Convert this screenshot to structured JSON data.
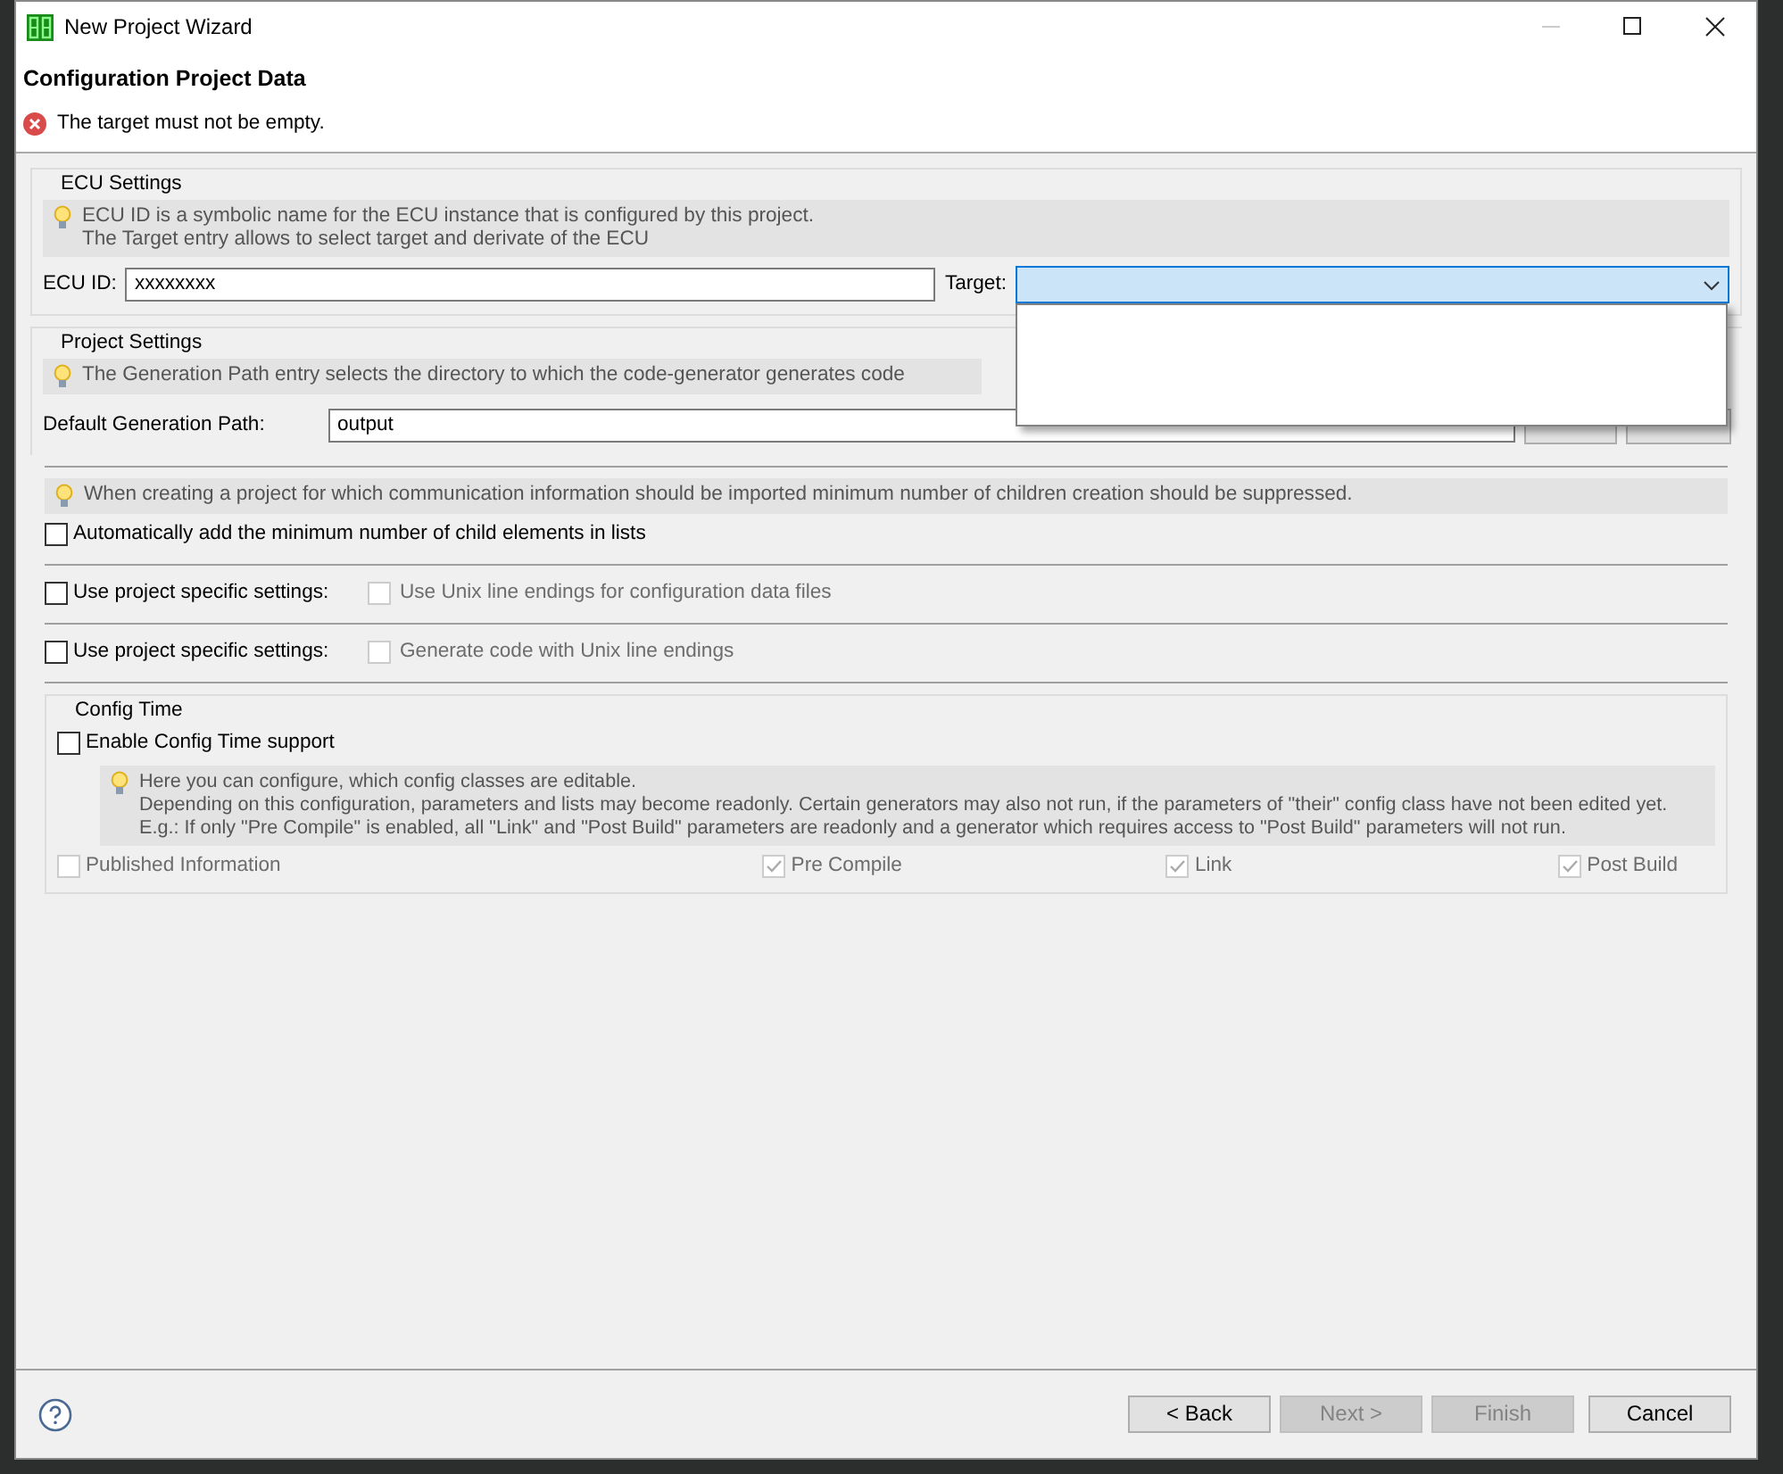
{
  "window": {
    "title": "New Project Wizard"
  },
  "header": {
    "title": "Configuration Project Data",
    "error": "The target must not be empty."
  },
  "ecu_settings": {
    "legend": "ECU Settings",
    "info": [
      "ECU ID is a symbolic name for the ECU instance that is configured by this project.",
      "The Target entry allows to select target and derivate of the ECU"
    ],
    "ecu_id": {
      "label": "ECU ID:",
      "value": "xxxxxxxx"
    },
    "target": {
      "label": "Target:",
      "expanded": true
    }
  },
  "project_settings": {
    "legend": "Project Settings",
    "info": [
      "The Generation Path entry selects the directory to which the code-generator generates code"
    ],
    "path": {
      "label": "Default Generation Path:",
      "value": "output"
    }
  },
  "options": [
    {
      "kind": "info",
      "text": "When creating a project for which communication information should be imported minimum number of children creation should be suppressed."
    },
    {
      "kind": "checkbox",
      "label": "Automatically add the minimum number of child elements in lists",
      "checked": false
    },
    {
      "kind": "pair",
      "label": "Use project specific settings:",
      "checked": false,
      "sub": {
        "label": "Use Unix line endings for configuration data files",
        "checked": false,
        "disabled": true
      }
    },
    {
      "kind": "pair",
      "label": "Use project specific settings:",
      "checked": false,
      "sub": {
        "label": "Generate code with Unix line endings",
        "checked": false,
        "disabled": true
      }
    }
  ],
  "config_time": {
    "legend": "Config Time",
    "enable": {
      "label": "Enable Config Time support",
      "checked": false
    },
    "info": [
      "Here you can configure, which config classes are editable.",
      "Depending on this configuration, parameters and lists may become readonly. Certain generators may also not run, if the parameters of \"their\" config class have not been edited yet.",
      "E.g.: If only \"Pre Compile\" is enabled, all \"Link\" and \"Post Build\" parameters are readonly and a generator which requires access to \"Post Build\" parameters will not run."
    ],
    "classes": [
      {
        "label": "Published Information",
        "checked": false,
        "disabled": true
      },
      {
        "label": "Pre Compile",
        "checked": true,
        "disabled": true
      },
      {
        "label": "Link",
        "checked": true,
        "disabled": true
      },
      {
        "label": "Post Build",
        "checked": true,
        "disabled": true
      }
    ]
  },
  "footer": {
    "buttons": [
      {
        "label": "< Back",
        "disabled": false
      },
      {
        "label": "Next >",
        "disabled": true
      },
      {
        "label": "Finish",
        "disabled": true
      },
      {
        "label": "Cancel",
        "disabled": false
      }
    ]
  }
}
